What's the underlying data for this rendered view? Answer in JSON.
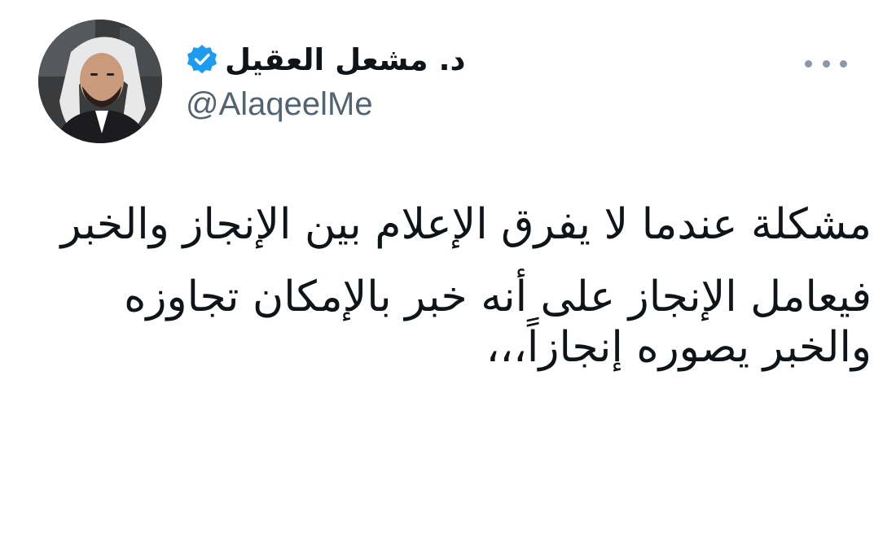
{
  "tweet": {
    "author": {
      "display_name": "د. مشعل العقيل",
      "handle": "@AlaqeelMe",
      "verified": true,
      "avatar_icon": "profile-photo"
    },
    "more_icon": "more-options-icon",
    "paragraphs": [
      "مشكلة عندما لا يفرق الإعلام بين الإنجاز والخبر",
      "فيعامل الإنجاز على أنه خبر بالإمكان تجاوزه والخبر يصوره إنجازاً،،،"
    ]
  },
  "colors": {
    "text_primary": "#0f1419",
    "text_secondary": "#536471",
    "verified_blue": "#1d9bf0",
    "more_dots": "#8b98a5"
  }
}
